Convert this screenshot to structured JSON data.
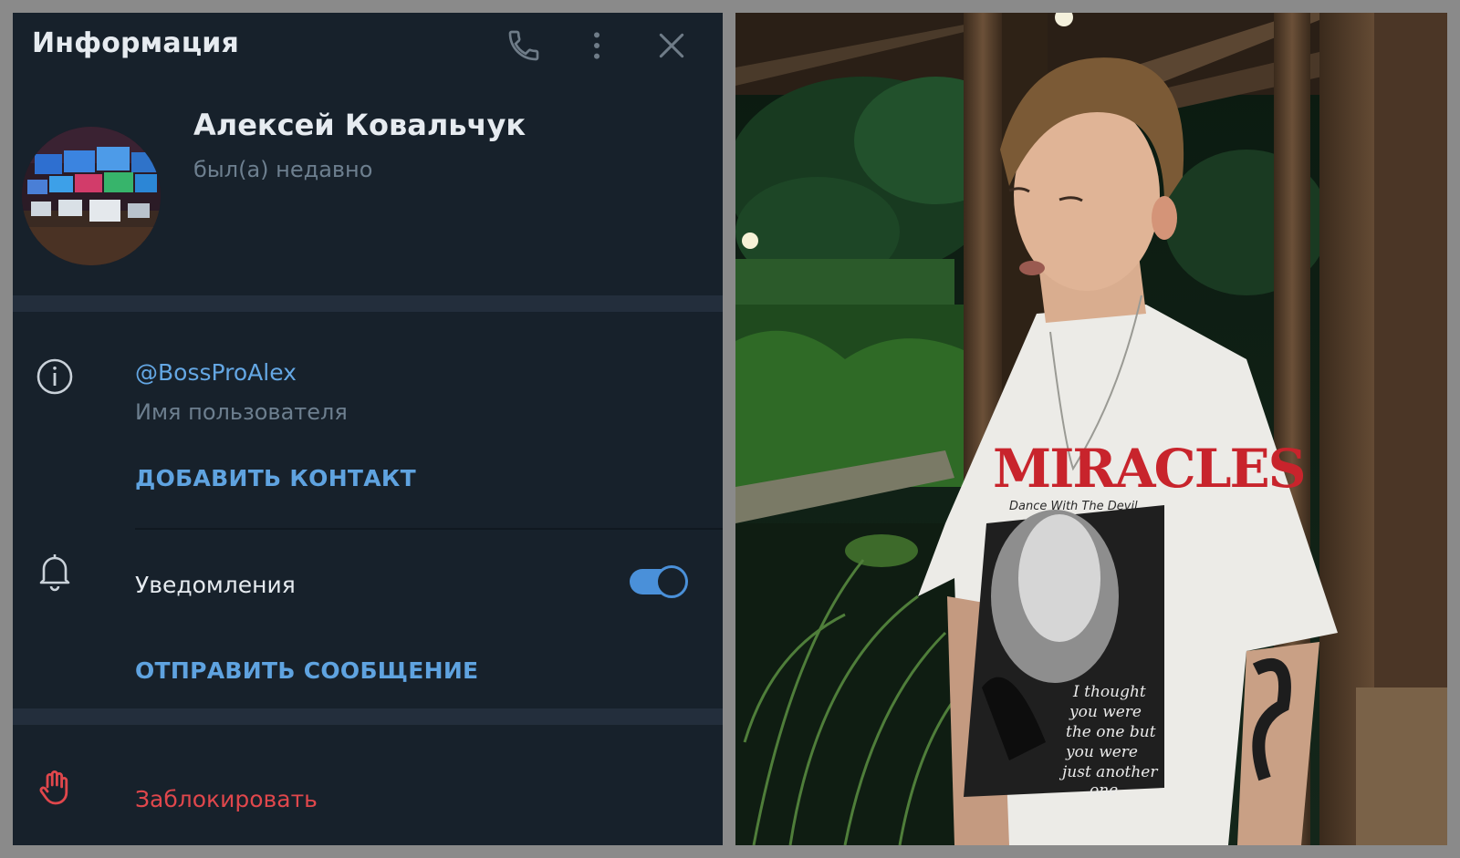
{
  "header": {
    "title": "Информация"
  },
  "profile": {
    "name": "Алексей Ковальчук",
    "status": "был(а) недавно"
  },
  "info": {
    "username": "@BossProAlex",
    "username_caption": "Имя пользователя",
    "add_contact": "ДОБАВИТЬ КОНТАКТ"
  },
  "notifications": {
    "label": "Уведомления",
    "enabled": true,
    "send_message": "ОТПРАВИТЬ СООБЩЕНИЕ"
  },
  "block": {
    "label": "Заблокировать"
  },
  "photo": {
    "shirt_text": "MIRACLES",
    "shirt_subtext": "Dance With The Devil",
    "shirt_script": [
      "I thought",
      "you were",
      "the one but",
      "you were",
      "just another",
      "one"
    ]
  },
  "colors": {
    "panel_bg": "#17212b",
    "accent": "#5fa3e0",
    "danger": "#e0474c",
    "muted_text": "#6d7f8f"
  },
  "icons": [
    "phone-icon",
    "more-vertical-icon",
    "close-icon",
    "info-icon",
    "bell-icon",
    "hand-stop-icon"
  ]
}
